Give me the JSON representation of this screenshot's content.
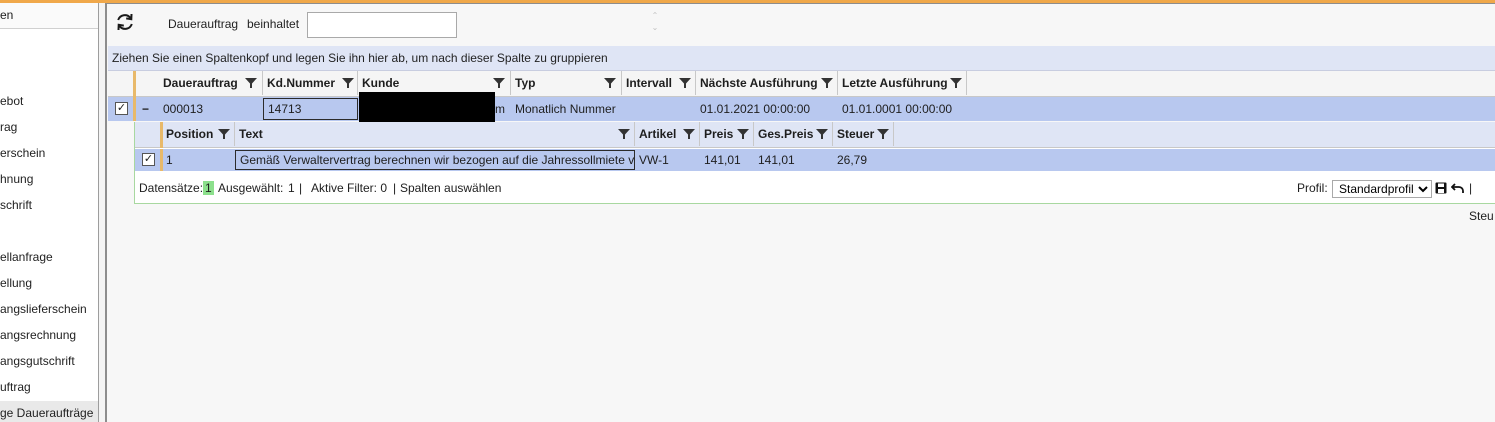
{
  "sidebar": {
    "header": "en",
    "items": [
      "ebot",
      "rag",
      "erschein",
      "hnung",
      "schrift",
      "ellanfrage",
      "ellung",
      "angslieferschein",
      "angsrechnung",
      "angsgutschrift",
      "uftrag",
      "ge Daueraufträge"
    ]
  },
  "toolbar": {
    "field_label": "Dauerauftrag",
    "operator_label": "beinhaltet",
    "search_value": ""
  },
  "group_panel": "Ziehen Sie einen Spaltenkopf und legen Sie ihn hier ab, um nach dieser Spalte zu gruppieren",
  "grid": {
    "columns": [
      "Dauerauftrag",
      "Kd.Nummer",
      "Kunde",
      "Typ",
      "Intervall",
      "Nächste Ausführung",
      "Letzte Ausführung"
    ],
    "row": {
      "expand": "−",
      "dauerauftrag": "000013",
      "kd_nummer": "14713",
      "kunde_tail": "m",
      "typ": "Monatlich Nummer",
      "intervall": "",
      "naechste": "01.01.2021 00:00:00",
      "letzte": "01.01.0001 00:00:00"
    }
  },
  "detail": {
    "columns": [
      "Position",
      "Text",
      "Artikel",
      "Preis",
      "Ges.Preis",
      "Steuer"
    ],
    "row": {
      "position": "1",
      "text": "Gemäß Verwaltervertrag berechnen wir bezogen auf die Jahressollmiete vc",
      "artikel": "VW-1",
      "preis": "141,01",
      "ges_preis": "141,01",
      "steuer": "26,79"
    },
    "footer": {
      "records_label": "Datensätze:",
      "records_count": "1",
      "selected_label": "Ausgewählt:",
      "selected_count": "1",
      "sep1": "|",
      "filter_label": "Aktive Filter: 0",
      "sep2": "|",
      "columns_link": "Spalten auswählen",
      "profile_label": "Profil:",
      "profile_value": "Standardprofil",
      "steu_tail": "| Steu"
    }
  },
  "colors": {
    "selection_row": "#b8c8ef",
    "group_panel": "#dfe5f5",
    "accent_orange": "#e8b96a",
    "badge_green": "#8ce08c"
  }
}
